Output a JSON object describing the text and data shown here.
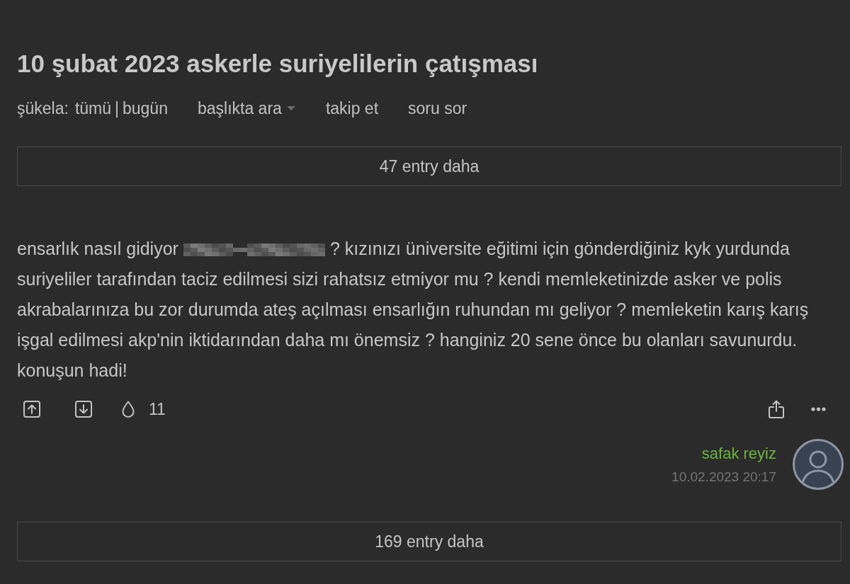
{
  "topic": {
    "title": "10 şubat 2023 askerle suriyelilerin çatışması"
  },
  "nav": {
    "sort_label": "şükela:",
    "sort_options": [
      {
        "label": "tümü"
      },
      {
        "label": "bugün"
      }
    ],
    "separator": "|",
    "links": [
      {
        "label": "başlıkta ara",
        "kind": "dropdown"
      },
      {
        "label": "takip et",
        "kind": "link"
      },
      {
        "label": "soru sor",
        "kind": "link"
      }
    ]
  },
  "more_before": {
    "label": "47 entry daha"
  },
  "entry": {
    "parts": [
      {
        "kind": "text",
        "text": "ensarlık nasıl gidiyor"
      },
      {
        "kind": "redacted"
      },
      {
        "kind": "text",
        "text": "? kızınızı üniversite eğitimi için gönderdiğiniz kyk yurdunda suriyeliler tarafından taciz edilmesi sizi rahatsız etmiyor mu ? kendi memleketinizde asker ve polis akrabalarınıza bu zor durumda ateş açılması ensarlığın ruhundan mı geliyor ? memleketin karış karış işgal edilmesi akp'nin iktidarından daha mı önemsiz ? hanginiz 20 sene önce bu olanları savunurdu. konuşun hadi!"
      }
    ],
    "favorite_count": "11",
    "author": "safak reyiz",
    "date": "10.02.2023 20:17"
  },
  "more_after": {
    "label": "169 entry daha"
  }
}
